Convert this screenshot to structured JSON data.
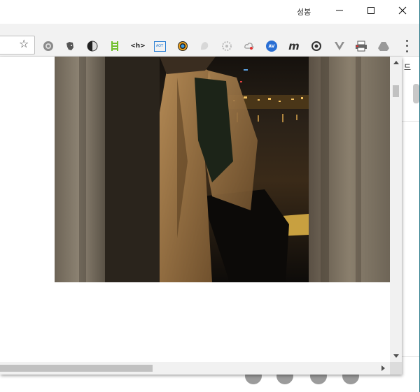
{
  "titlebar": {
    "profile_name": "성봉",
    "minimize": "minimize-icon",
    "maximize": "maximize-icon",
    "close": "close-icon"
  },
  "toolbar": {
    "bookmark_icon": "star-icon",
    "extensions": [
      "gear-badge-icon",
      "evernote-icon",
      "contrast-icon",
      "ladder-icon",
      "header-tag-icon",
      "aot-icon",
      "color-wheel-icon",
      "ghost-icon",
      "settings-icon",
      "cloud-icon",
      "av-icon",
      "m-letter-icon",
      "refresh-icon",
      "vue-icon",
      "printer-icon",
      "drive-icon"
    ],
    "header_tag_label": "<h>",
    "aot_label": "AOT",
    "av_label": "AV",
    "m_label": "m",
    "menu_icon": "menu-dots-icon"
  },
  "page": {
    "right_rail_text": "드",
    "social_icons": [
      "facebook-icon",
      "twitter-icon",
      "pinterest-icon",
      "telegram-icon"
    ]
  },
  "popup": {
    "image_icon": "photo-image",
    "scroll_up": "scroll-up-icon",
    "scroll_down": "scroll-down-icon",
    "scroll_right": "scroll-right-icon"
  }
}
